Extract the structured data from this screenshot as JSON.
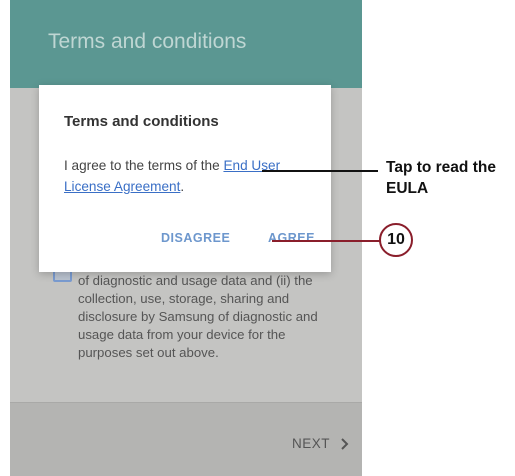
{
  "app_bar": {
    "title": "Terms and conditions"
  },
  "background": {
    "consent_text": "of diagnostic and usage data and (ii) the collection, use, storage, sharing and disclosure by Samsung of diagnostic and usage data from your device for the purposes set out above.",
    "next_label": "NEXT"
  },
  "dialog": {
    "title": "Terms and conditions",
    "body_prefix": "I agree to the terms of the ",
    "link_text": "End User License Agreement",
    "body_suffix": ".",
    "disagree_label": "DISAGREE",
    "agree_label": "AGREE"
  },
  "annotations": {
    "callout_text": "Tap to read the EULA",
    "step_number": "10",
    "accent_color": "#8a1e2b"
  },
  "colors": {
    "app_bar": "#5b9792",
    "link": "#3a6fc6",
    "dialog_button": "#6d97cd"
  },
  "icons": {
    "next": "chevron-right-icon"
  }
}
